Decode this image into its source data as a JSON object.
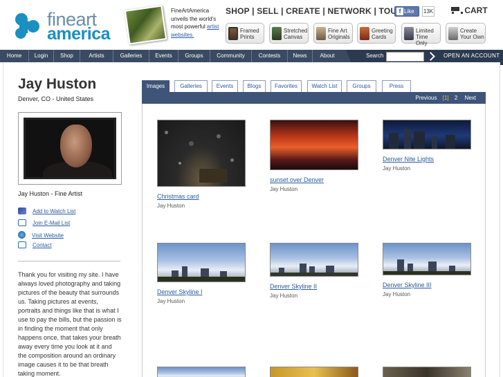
{
  "colors": {
    "brand_blue": "#1b8fc1",
    "nav_bar": "#3a4a62",
    "tab_active": "#3e5478",
    "link": "#2a5a9e"
  },
  "logo": {
    "line1": "fine",
    "line2": "art",
    "line3": "america"
  },
  "promo": {
    "text": "FineArtAmerica unveils the world's most powerful",
    "link": "artist websites."
  },
  "top_nav": {
    "shop": "SHOP",
    "sell": "SELL",
    "create": "CREATE",
    "network": "NETWORK",
    "tour": "TOUR",
    "separator": "|"
  },
  "facebook": {
    "like_label": "Like",
    "count": "13K"
  },
  "cart_label": "CART",
  "product_buttons": [
    {
      "line1": "Framed",
      "line2": "Prints",
      "icon": "framed-prints-icon"
    },
    {
      "line1": "Stretched",
      "line2": "Canvas",
      "icon": "stretched-canvas-icon"
    },
    {
      "line1": "Fine Art",
      "line2": "Originals",
      "icon": "originals-icon"
    },
    {
      "line1": "Greeting",
      "line2": "Cards",
      "icon": "greeting-cards-icon"
    },
    {
      "line1": "Limited",
      "line2": "Time Only",
      "icon": "limited-time-icon"
    },
    {
      "line1": "Create",
      "line2": "Your Own",
      "icon": "create-your-own-icon"
    }
  ],
  "nav_items": [
    "Home",
    "Login",
    "Shop",
    "Artists",
    "Galleries",
    "Events",
    "Groups",
    "Community",
    "Contests",
    "News",
    "About"
  ],
  "search": {
    "label": "Search",
    "value": ""
  },
  "open_account": "OPEN AN ACCOUNT",
  "artist": {
    "name": "Jay Huston",
    "location": "Denver, CO - United States",
    "caption": "Jay Huston - Fine Artist"
  },
  "side_links": [
    {
      "label": "Add to Watch List",
      "icon": "watchlist-icon"
    },
    {
      "label": "Join E-Mail List",
      "icon": "email-icon"
    },
    {
      "label": "Visit Website",
      "icon": "globe-icon"
    },
    {
      "label": "Contact",
      "icon": "envelope-icon"
    }
  ],
  "bio": "Thank you for visiting my site. I have always loved photography and taking pictures of the beauty that surrounds us. Taking pictures at events, portraits and things like that is what I use to pay the bills, but the passion is in finding the moment that only happens once, that takes your breath away every time you look at it and the composition around an ordinary image causes it to be that breath taking moment.",
  "tabs": [
    "Images",
    "Galleries",
    "Events",
    "Blogs",
    "Favorites",
    "Watch List",
    "Groups",
    "Press"
  ],
  "active_tab": "Images",
  "pager": {
    "previous": "Previous",
    "current": "[1]",
    "page2": "2",
    "next": "Next"
  },
  "artworks": [
    {
      "title": "Christmas card",
      "artist": "Jay Huston"
    },
    {
      "title": "sunset over Denver",
      "artist": "Jay Huston"
    },
    {
      "title": "Denver Nite Lights",
      "artist": "Jay Huston"
    },
    {
      "title": "Denver Skyline I",
      "artist": "Jay Huston"
    },
    {
      "title": "Denver Skyline II",
      "artist": "Jay Huston"
    },
    {
      "title": "Denver Skyline III",
      "artist": "Jay Huston"
    }
  ]
}
